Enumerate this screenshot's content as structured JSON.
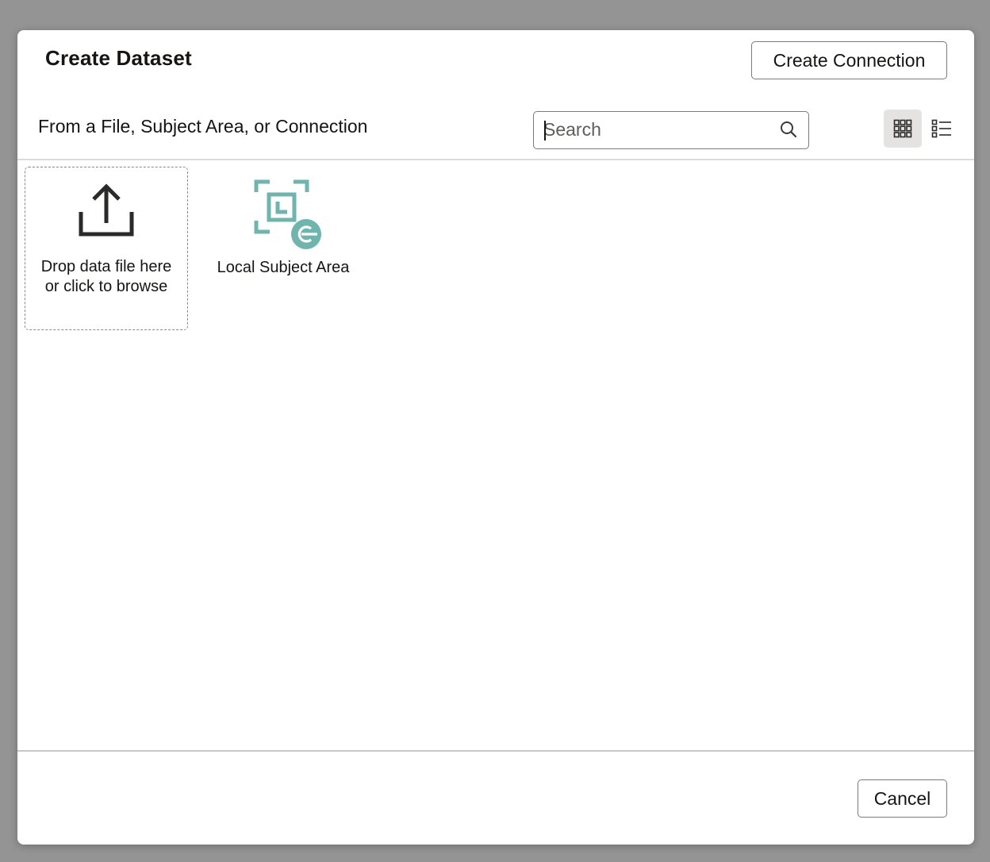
{
  "dialog": {
    "title": "Create Dataset",
    "create_connection_label": "Create Connection",
    "subtitle": "From a File, Subject Area, or Connection",
    "search": {
      "placeholder": "Search",
      "value": "",
      "icon": "search-icon"
    },
    "view_toggle": {
      "selected": "grid",
      "grid_icon": "grid-view-icon",
      "list_icon": "list-view-icon"
    },
    "tiles": [
      {
        "label": "Drop data file here or click to browse",
        "icon": "upload-icon"
      },
      {
        "label": "Local Subject Area",
        "icon": "local-subject-area-icon"
      }
    ],
    "colors": {
      "accent_teal": "#6eb5ad",
      "selected_view_bg": "#e4e3e1"
    },
    "cancel_label": "Cancel"
  }
}
